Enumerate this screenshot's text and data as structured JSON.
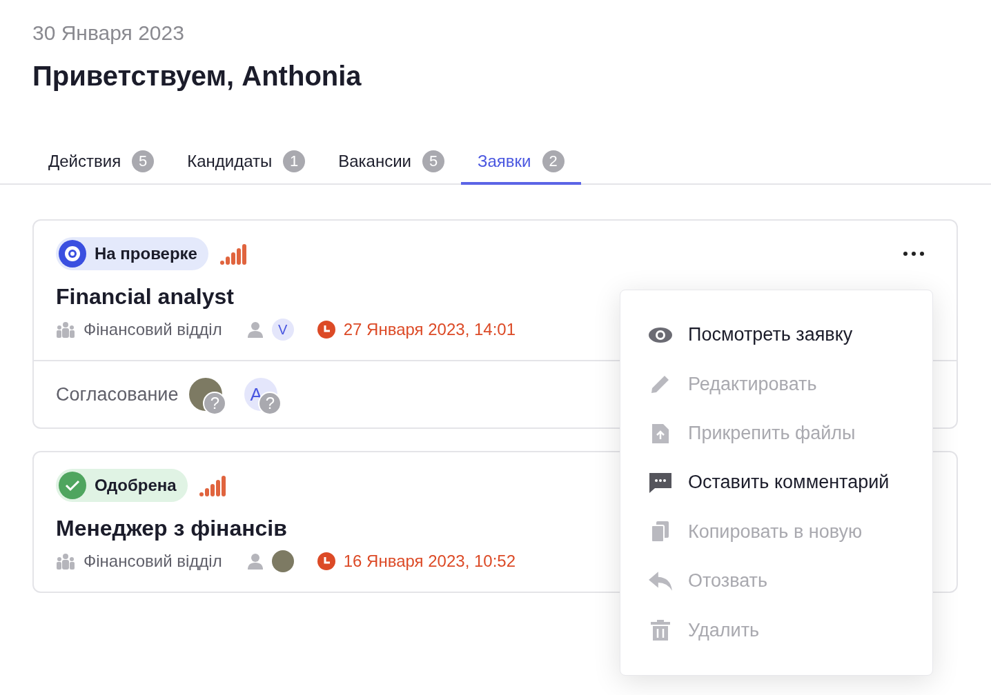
{
  "date": "30 Января 2023",
  "greeting": "Приветствуем, Anthonia",
  "tabs": [
    {
      "label": "Действия",
      "count": "5",
      "selected": false
    },
    {
      "label": "Кандидаты",
      "count": "1",
      "selected": false
    },
    {
      "label": "Вакансии",
      "count": "5",
      "selected": false
    },
    {
      "label": "Заявки",
      "count": "2",
      "selected": true
    }
  ],
  "requests": [
    {
      "status": {
        "kind": "review",
        "label": "На проверке"
      },
      "title": "Financial analyst",
      "department": "Фінансовий відділ",
      "owner": {
        "kind": "initials",
        "text": "V"
      },
      "deadline": "27 Января 2023, 14:01",
      "approval": {
        "label": "Согласование",
        "approvers": [
          {
            "kind": "photo",
            "badge": "?"
          },
          {
            "kind": "initials",
            "text": "A",
            "badge": "?"
          }
        ]
      }
    },
    {
      "status": {
        "kind": "approved",
        "label": "Одобрена"
      },
      "title": "Менеджер з фінансів",
      "department": "Фінансовий відділ",
      "owner": {
        "kind": "photo"
      },
      "deadline": "16 Января 2023, 10:52"
    }
  ],
  "menu": [
    {
      "kind": "view",
      "label": "Посмотреть заявку",
      "disabled": false
    },
    {
      "kind": "edit",
      "label": "Редактировать",
      "disabled": true
    },
    {
      "kind": "attach",
      "label": "Прикрепить файлы",
      "disabled": true
    },
    {
      "kind": "comment",
      "label": "Оставить комментарий",
      "disabled": false
    },
    {
      "kind": "copy",
      "label": "Копировать в новую",
      "disabled": true
    },
    {
      "kind": "revoke",
      "label": "Отозвать",
      "disabled": true
    },
    {
      "kind": "delete",
      "label": "Удалить",
      "disabled": true
    }
  ]
}
